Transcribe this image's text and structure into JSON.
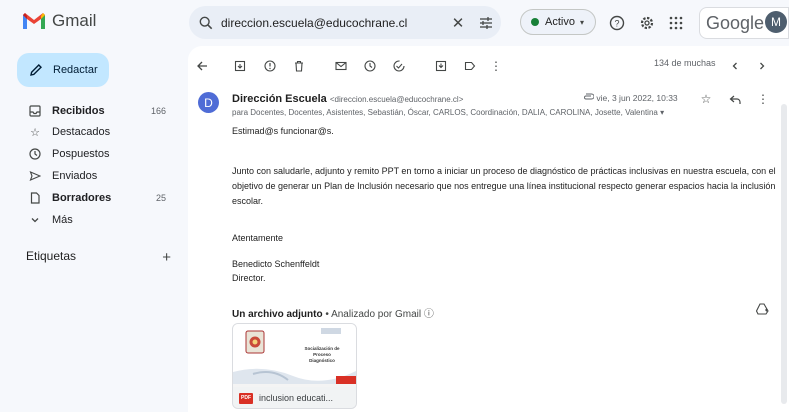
{
  "app": {
    "logo_text": "Gmail",
    "brand": "Google",
    "avatar_letter": "M"
  },
  "search": {
    "query": "direccion.escuela@educochrane.cl"
  },
  "status": {
    "label": "Activo"
  },
  "compose": {
    "label": "Redactar"
  },
  "nav": [
    {
      "label": "Recibidos",
      "count": "166",
      "bold": true,
      "icon": "inbox-icon"
    },
    {
      "label": "Destacados",
      "count": "",
      "bold": false,
      "icon": "star-icon"
    },
    {
      "label": "Pospuestos",
      "count": "",
      "bold": false,
      "icon": "clock-icon"
    },
    {
      "label": "Enviados",
      "count": "",
      "bold": false,
      "icon": "send-icon"
    },
    {
      "label": "Borradores",
      "count": "25",
      "bold": true,
      "icon": "draft-icon"
    },
    {
      "label": "Más",
      "count": "",
      "bold": false,
      "icon": "chevron-down-icon"
    }
  ],
  "labels_section": {
    "title": "Etiquetas"
  },
  "pager": {
    "text": "134 de muchas"
  },
  "email": {
    "avatar_letter": "D",
    "sender_name": "Dirección Escuela",
    "sender_addr": "<direccion.escuela@educochrane.cl>",
    "recipients": "para Docentes, Docentes, Asistentes, Sebastián, Óscar, CARLOS, Coordinación, DALIA, CAROLINA, Josette, Valentina",
    "date": "vie, 3 jun 2022, 10:33",
    "greeting": "Estimad@s funcionar@s.",
    "paragraph": "Junto con saludarle, adjunto y remito PPT en torno a iniciar un proceso de diagnóstico de prácticas inclusivas en nuestra escuela, con el objetivo de generar un Plan de Inclusión necesario que nos entregue una línea institucional respecto generar espacios hacia la inclusión escolar.",
    "closing": "Atentamente",
    "signature_name": "Benedicto Schenffeldt",
    "signature_title": "Director."
  },
  "attachments": {
    "title": "Un archivo adjunto",
    "scan_note": "Analizado por Gmail",
    "file": {
      "type_badge": "PDF",
      "name": "inclusion educati...",
      "slide_title": "Socialización de Proceso Diagnóstico"
    }
  },
  "colors": {
    "accent": "#0b57d0",
    "compose_bg": "#c2e7ff",
    "pdf_red": "#d93025",
    "avatar_blue": "#4f6cd6"
  }
}
